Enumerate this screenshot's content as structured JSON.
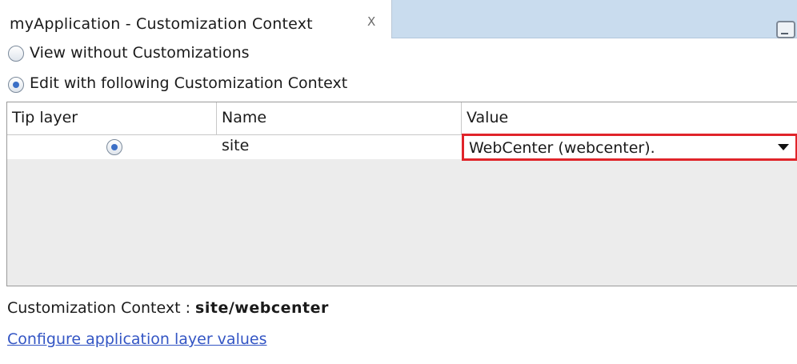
{
  "tab": {
    "title": "myApplication - Customization Context",
    "close_glyph": "X"
  },
  "options": {
    "view_without": "View without Customizations",
    "edit_with": "Edit with following Customization Context",
    "selected": "edit_with"
  },
  "table": {
    "headers": [
      "Tip layer",
      "Name",
      "Value"
    ],
    "rows": [
      {
        "tip_layer_selected": true,
        "name": "site",
        "value": "WebCenter (webcenter)."
      }
    ]
  },
  "context": {
    "label": "Customization Context : ",
    "value": "site/webcenter"
  },
  "link": {
    "configure": "Configure application layer values"
  },
  "colors": {
    "highlight_border": "#e0242a",
    "link": "#3355c4",
    "tab_strip": "#c9dcee",
    "radio_dot": "#3b6fc6"
  }
}
